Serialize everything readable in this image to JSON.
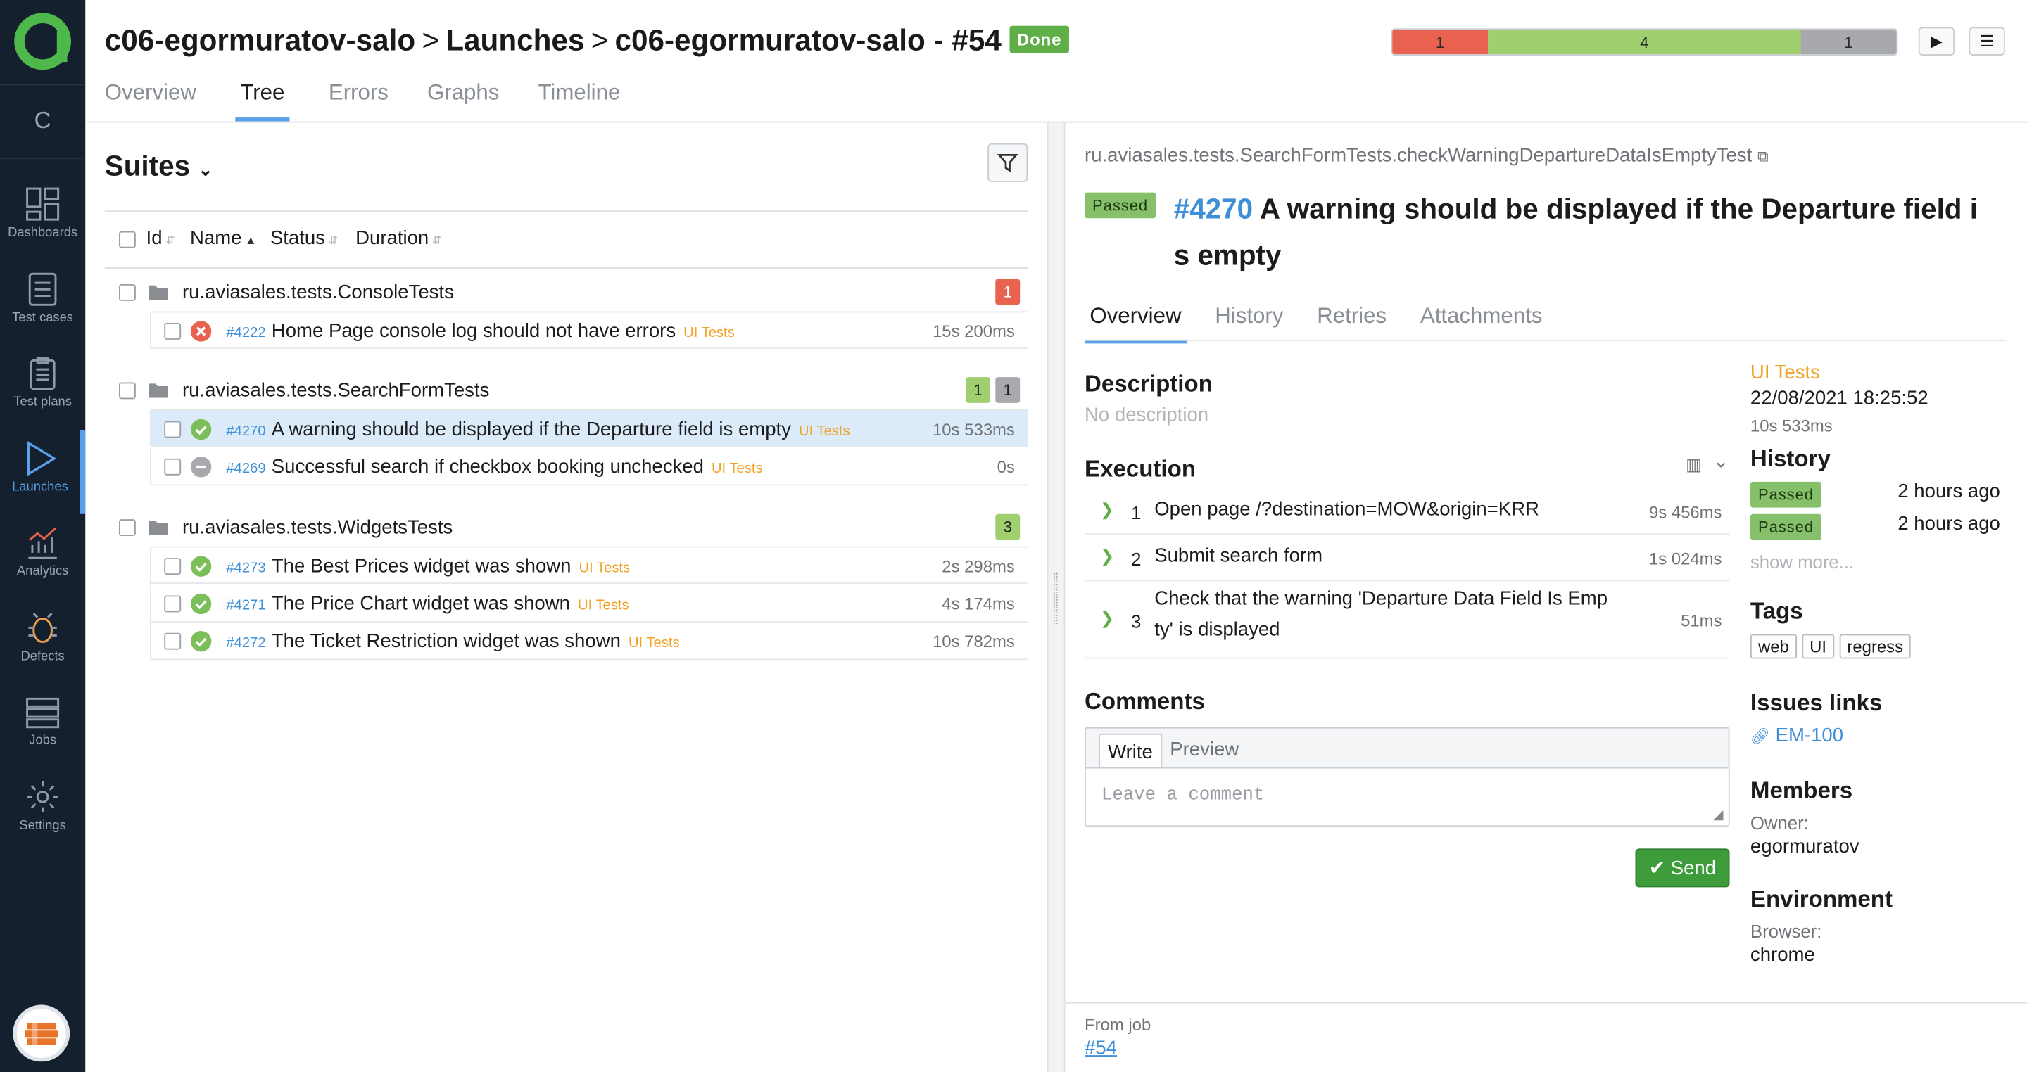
{
  "app": {
    "project_letter": "C"
  },
  "sidebar": {
    "items": [
      {
        "label": "Dashboards",
        "icon": "dashboards-icon"
      },
      {
        "label": "Test cases",
        "icon": "test-cases-icon"
      },
      {
        "label": "Test plans",
        "icon": "test-plans-icon"
      },
      {
        "label": "Launches",
        "icon": "launches-icon",
        "active": true
      },
      {
        "label": "Analytics",
        "icon": "analytics-icon"
      },
      {
        "label": "Defects",
        "icon": "defects-icon"
      },
      {
        "label": "Jobs",
        "icon": "jobs-icon"
      },
      {
        "label": "Settings",
        "icon": "settings-icon"
      }
    ]
  },
  "header": {
    "crumb1": "c06-egormuratov-salo",
    "crumb2": "Launches",
    "crumb3": "c06-egormuratov-salo - #54",
    "separator": ">",
    "status": "Done",
    "tabs": [
      "Overview",
      "Tree",
      "Errors",
      "Graphs",
      "Timeline"
    ],
    "active_tab": "Tree",
    "progress": [
      {
        "label": "1",
        "color": "#e8624f",
        "fraction": 0.19
      },
      {
        "label": "4",
        "color": "#9fcf6f",
        "fraction": 0.62
      },
      {
        "label": "1",
        "color": "#a7a9ac",
        "fraction": 0.19
      }
    ]
  },
  "tree": {
    "title": "Suites",
    "columns": {
      "id": "Id",
      "name": "Name",
      "status": "Status",
      "duration": "Duration"
    },
    "groups": [
      {
        "name": "ru.aviasales.tests.ConsoleTests",
        "badges": [
          {
            "v": "1",
            "color": "#e8624f"
          }
        ],
        "rows": [
          {
            "id": "#4222",
            "name": "Home Page console log should not have errors",
            "tag": "UI Tests",
            "dur": "15s 200ms",
            "status": "failed"
          }
        ]
      },
      {
        "name": "ru.aviasales.tests.SearchFormTests",
        "badges": [
          {
            "v": "1",
            "color": "#9fcf6f"
          },
          {
            "v": "1",
            "color": "#a7a9ac"
          }
        ],
        "rows": [
          {
            "id": "#4270",
            "name": "A warning should be displayed if the Departure field is empty",
            "tag": "UI Tests",
            "dur": "10s 533ms",
            "status": "passed",
            "selected": true
          },
          {
            "id": "#4269",
            "name": "Successful search if checkbox booking unchecked",
            "tag": "UI Tests",
            "dur": "0s",
            "status": "skipped"
          }
        ]
      },
      {
        "name": "ru.aviasales.tests.WidgetsTests",
        "badges": [
          {
            "v": "3",
            "color": "#9fcf6f"
          }
        ],
        "rows": [
          {
            "id": "#4273",
            "name": "The Best Prices widget was shown",
            "tag": "UI Tests",
            "dur": "2s 298ms",
            "status": "passed"
          },
          {
            "id": "#4271",
            "name": "The Price Chart widget was shown",
            "tag": "UI Tests",
            "dur": "4s 174ms",
            "status": "passed"
          },
          {
            "id": "#4272",
            "name": "The Ticket Restriction widget was shown",
            "tag": "UI Tests",
            "dur": "10s 782ms",
            "status": "passed"
          }
        ]
      }
    ]
  },
  "detail": {
    "fqn": "ru.aviasales.tests.SearchFormTests.checkWarningDepartureDataIsEmptyTest",
    "status": "Passed",
    "id": "#4270",
    "title_line1": "A warning should be displayed if the Departure field i",
    "title_line2": "s empty",
    "tabs": [
      "Overview",
      "History",
      "Retries",
      "Attachments"
    ],
    "description_label": "Description",
    "description": "No description",
    "execution_label": "Execution",
    "steps": [
      {
        "n": "1",
        "text": "Open page /?destination=MOW&origin=KRR",
        "dur": "9s 456ms"
      },
      {
        "n": "2",
        "text": "Submit search form",
        "dur": "1s 024ms"
      },
      {
        "n": "3",
        "text": "Check that the warning 'Departure Data Field Is Emp ty' is displayed",
        "dur": "51ms"
      }
    ],
    "comments_label": "Comments",
    "write": "Write",
    "preview": "Preview",
    "comment_placeholder": "Leave a comment",
    "send": "Send",
    "side": {
      "layer": "UI Tests",
      "date": "22/08/2021 18:25:52",
      "duration": "10s 533ms",
      "history_label": "History",
      "history": [
        {
          "status": "Passed",
          "when": "2 hours ago"
        },
        {
          "status": "Passed",
          "when": "2 hours ago"
        }
      ],
      "show_more": "show more...",
      "tags_label": "Tags",
      "tags": [
        "web",
        "UI",
        "regress"
      ],
      "issues_label": "Issues links",
      "issue": "EM-100",
      "members_label": "Members",
      "owner_label": "Owner:",
      "owner": "egormuratov",
      "env_label": "Environment",
      "browser_label": "Browser:",
      "browser": "chrome"
    },
    "footer": {
      "from_job": "From job",
      "job": "#54"
    }
  }
}
